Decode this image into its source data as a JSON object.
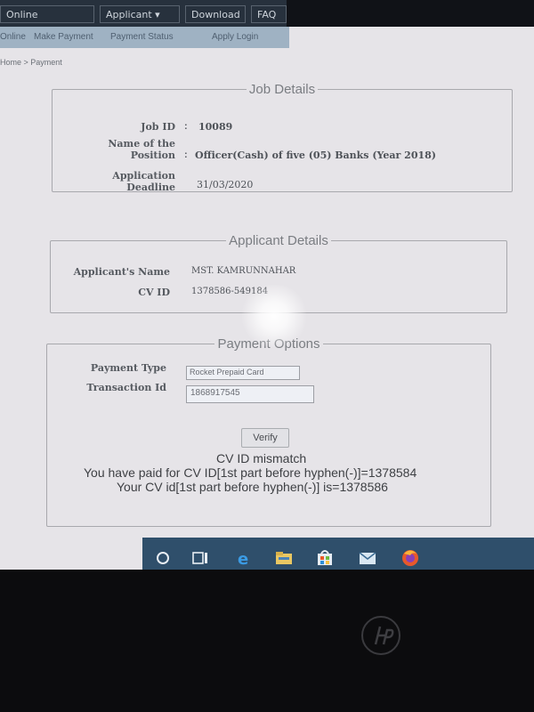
{
  "nav": {
    "tabs": [
      "Online Application",
      "Applicant ▾",
      "Download",
      "FAQ"
    ],
    "subnav": [
      "Online",
      "Make Payment",
      "Payment Status",
      "Apply Login"
    ],
    "breadcrumb": "Home > Payment"
  },
  "job_details": {
    "legend": "Job Details",
    "job_id_label": "Job ID",
    "job_id_value": "10089",
    "position_label_1": "Name of the",
    "position_label_2": "Position",
    "position_value": "Officer(Cash) of five (05) Banks (Year 2018)",
    "deadline_label_1": "Application",
    "deadline_label_2": "Deadline",
    "deadline_value": "31/03/2020",
    "colon": ":"
  },
  "applicant_details": {
    "legend": "Applicant Details",
    "name_label": "Applicant's Name",
    "name_value": "MST. KAMRUNNAHAR",
    "cv_label": "CV ID",
    "cv_value": "1378586-549184"
  },
  "payment_options": {
    "legend": "Payment Options",
    "type_label": "Payment Type",
    "type_value": "Rocket Prepaid Card",
    "txn_label": "Transaction Id",
    "txn_value": "1868917545",
    "verify_label": "Verify",
    "msg_title": "CV ID mismatch",
    "msg_line1": "You have paid for CV ID[1st part before hyphen(-)]=1378584",
    "msg_line2": "Your CV id[1st part before hyphen(-)] is=1378586"
  },
  "taskbar": {
    "icons": [
      "cortana-icon",
      "task-view-icon",
      "edge-icon",
      "file-explorer-icon",
      "store-icon",
      "mail-icon",
      "firefox-icon"
    ]
  }
}
